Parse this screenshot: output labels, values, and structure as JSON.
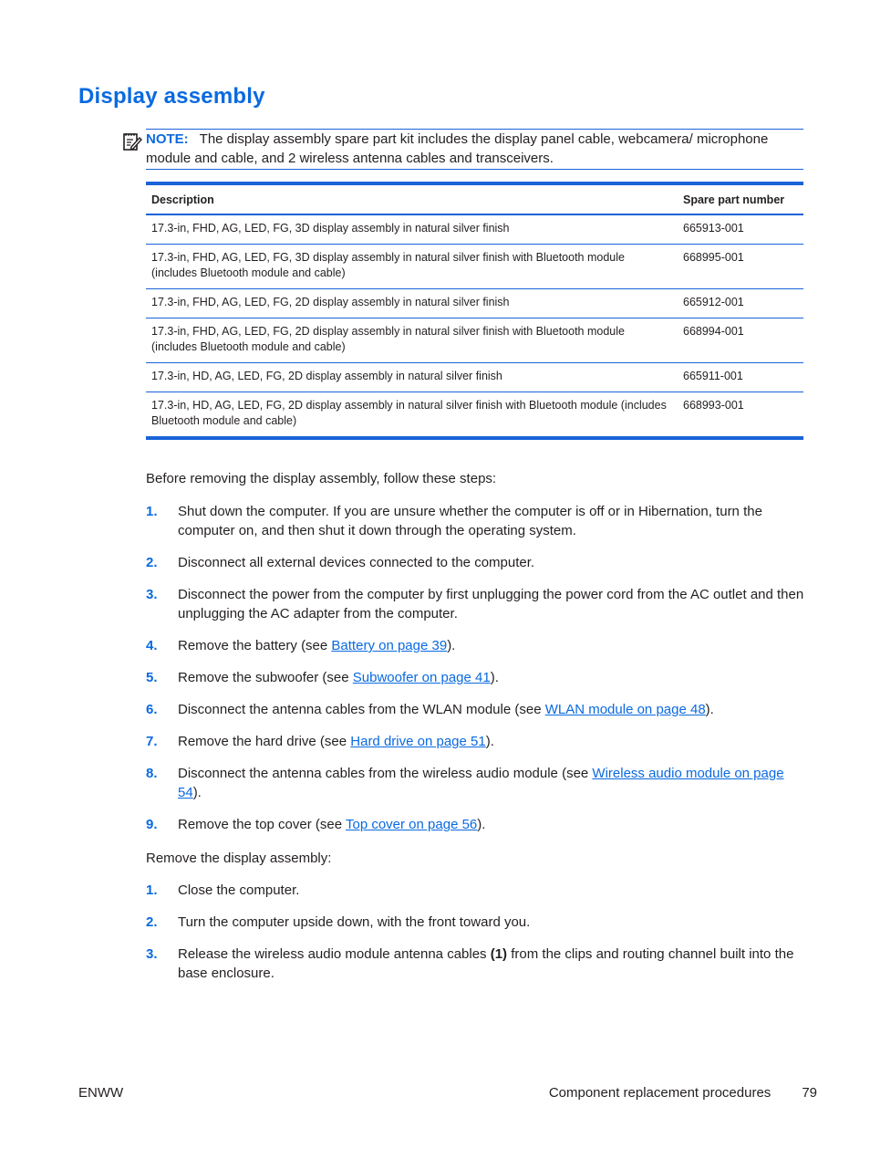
{
  "page": {
    "title": "Display assembly",
    "note": {
      "icon": "note-pencil-icon",
      "label": "NOTE:",
      "text": "The display assembly spare part kit includes the display panel cable, webcamera/ microphone module and cable, and 2 wireless antenna cables and transceivers."
    },
    "parts_table": {
      "headers": {
        "description": "Description",
        "part_number": "Spare part number"
      },
      "rows": [
        {
          "description": "17.3-in, FHD, AG, LED, FG, 3D display assembly in natural silver finish",
          "part_number": "665913-001"
        },
        {
          "description": "17.3-in, FHD, AG, LED, FG, 3D display assembly in natural silver finish with Bluetooth module (includes Bluetooth module and cable)",
          "part_number": "668995-001"
        },
        {
          "description": "17.3-in, FHD, AG, LED, FG, 2D display assembly in natural silver finish",
          "part_number": "665912-001"
        },
        {
          "description": "17.3-in, FHD, AG, LED, FG, 2D display assembly in natural silver finish with Bluetooth module (includes Bluetooth module and cable)",
          "part_number": "668994-001"
        },
        {
          "description": "17.3-in, HD, AG, LED, FG, 2D display assembly in natural silver finish",
          "part_number": "665911-001"
        },
        {
          "description": "17.3-in, HD, AG, LED, FG, 2D display assembly in natural silver finish with Bluetooth module (includes Bluetooth module and cable)",
          "part_number": "668993-001"
        }
      ]
    },
    "before_intro": "Before removing the display assembly, follow these steps:",
    "before_steps": [
      {
        "num": "1.",
        "text": "Shut down the computer. If you are unsure whether the computer is off or in Hibernation, turn the computer on, and then shut it down through the operating system."
      },
      {
        "num": "2.",
        "text": "Disconnect all external devices connected to the computer."
      },
      {
        "num": "3.",
        "text": "Disconnect the power from the computer by first unplugging the power cord from the AC outlet and then unplugging the AC adapter from the computer."
      },
      {
        "num": "4.",
        "pre": "Remove the battery (see ",
        "link": "Battery on page 39",
        "post": ")."
      },
      {
        "num": "5.",
        "pre": "Remove the subwoofer (see ",
        "link": "Subwoofer on page 41",
        "post": ")."
      },
      {
        "num": "6.",
        "pre": "Disconnect the antenna cables from the WLAN module (see ",
        "link": "WLAN module on page 48",
        "post": ")."
      },
      {
        "num": "7.",
        "pre": "Remove the hard drive (see ",
        "link": "Hard drive on page 51",
        "post": ")."
      },
      {
        "num": "8.",
        "pre": "Disconnect the antenna cables from the wireless audio module (see ",
        "link": "Wireless audio module on page 54",
        "post": ")."
      },
      {
        "num": "9.",
        "pre": "Remove the top cover (see ",
        "link": "Top cover on page 56",
        "post": ")."
      }
    ],
    "remove_intro": "Remove the display assembly:",
    "remove_steps": [
      {
        "num": "1.",
        "text": "Close the computer."
      },
      {
        "num": "2.",
        "text": "Turn the computer upside down, with the front toward you."
      },
      {
        "num": "3.",
        "pre": "Release the wireless audio module antenna cables ",
        "bold": "(1)",
        "post": " from the clips and routing channel built into the base enclosure."
      }
    ],
    "footer": {
      "left": "ENWW",
      "section": "Component replacement procedures",
      "page_number": "79"
    },
    "colors": {
      "accent": "#0a6ae0",
      "rule": "#1a63d8",
      "text": "#231f20"
    }
  }
}
